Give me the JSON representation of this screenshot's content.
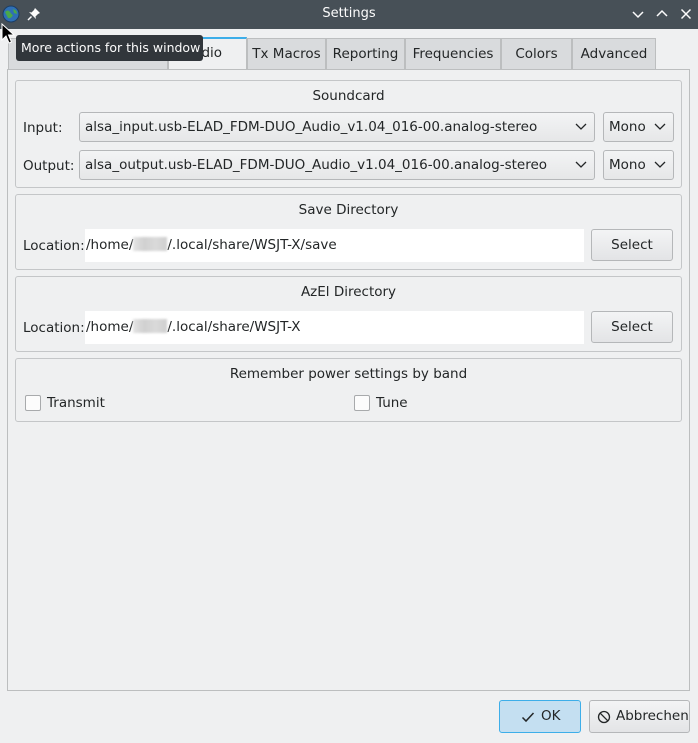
{
  "window": {
    "title": "Settings",
    "app_icon": "globe-icon",
    "pin_icon": "pin-icon",
    "controls": [
      "minimize-icon",
      "maximize-icon",
      "close-icon"
    ],
    "tooltip": "More actions for this window"
  },
  "tabs": [
    {
      "label": "udio",
      "active": true
    },
    {
      "label": "Tx Macros"
    },
    {
      "label": "Reporting"
    },
    {
      "label": "Frequencies"
    },
    {
      "label": "Colors"
    },
    {
      "label": "Advanced"
    }
  ],
  "soundcard": {
    "title": "Soundcard",
    "input_label": "Input:",
    "input_value": "alsa_input.usb-ELAD_FDM-DUO_Audio_v1.04_016-00.analog-stereo",
    "input_channel": "Mono",
    "output_label": "Output:",
    "output_value": "alsa_output.usb-ELAD_FDM-DUO_Audio_v1.04_016-00.analog-stereo",
    "output_channel": "Mono"
  },
  "save_dir": {
    "title": "Save Directory",
    "location_label": "Location:",
    "path_prefix": "/home/",
    "path_suffix": "/.local/share/WSJT-X/save",
    "select_label": "Select"
  },
  "azel_dir": {
    "title": "AzEl Directory",
    "location_label": "Location:",
    "path_prefix": "/home/",
    "path_suffix": "/.local/share/WSJT-X",
    "select_label": "Select"
  },
  "power": {
    "title": "Remember power settings by band",
    "transmit_label": "Transmit",
    "transmit_checked": false,
    "tune_label": "Tune",
    "tune_checked": false
  },
  "footer": {
    "ok_label": "OK",
    "ok_icon": "checkmark-icon",
    "cancel_label": "Abbrechen",
    "cancel_icon": "cancel-icon"
  },
  "colors": {
    "titlebar": "#475057",
    "accent": "#3daee9",
    "window_bg": "#eff0f1"
  }
}
